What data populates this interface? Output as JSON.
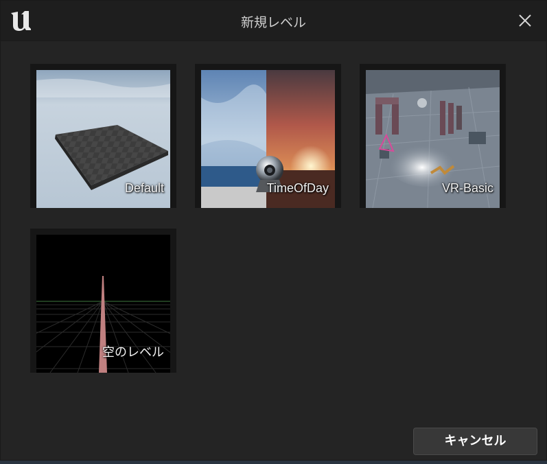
{
  "dialog": {
    "title": "新規レベル",
    "cancel_label": "キャンセル"
  },
  "templates": [
    {
      "label": "Default"
    },
    {
      "label": "TimeOfDay"
    },
    {
      "label": "VR-Basic"
    },
    {
      "label": "空のレベル"
    }
  ],
  "icons": {
    "app_logo": "unreal-engine-logo-icon",
    "close": "close-icon"
  }
}
